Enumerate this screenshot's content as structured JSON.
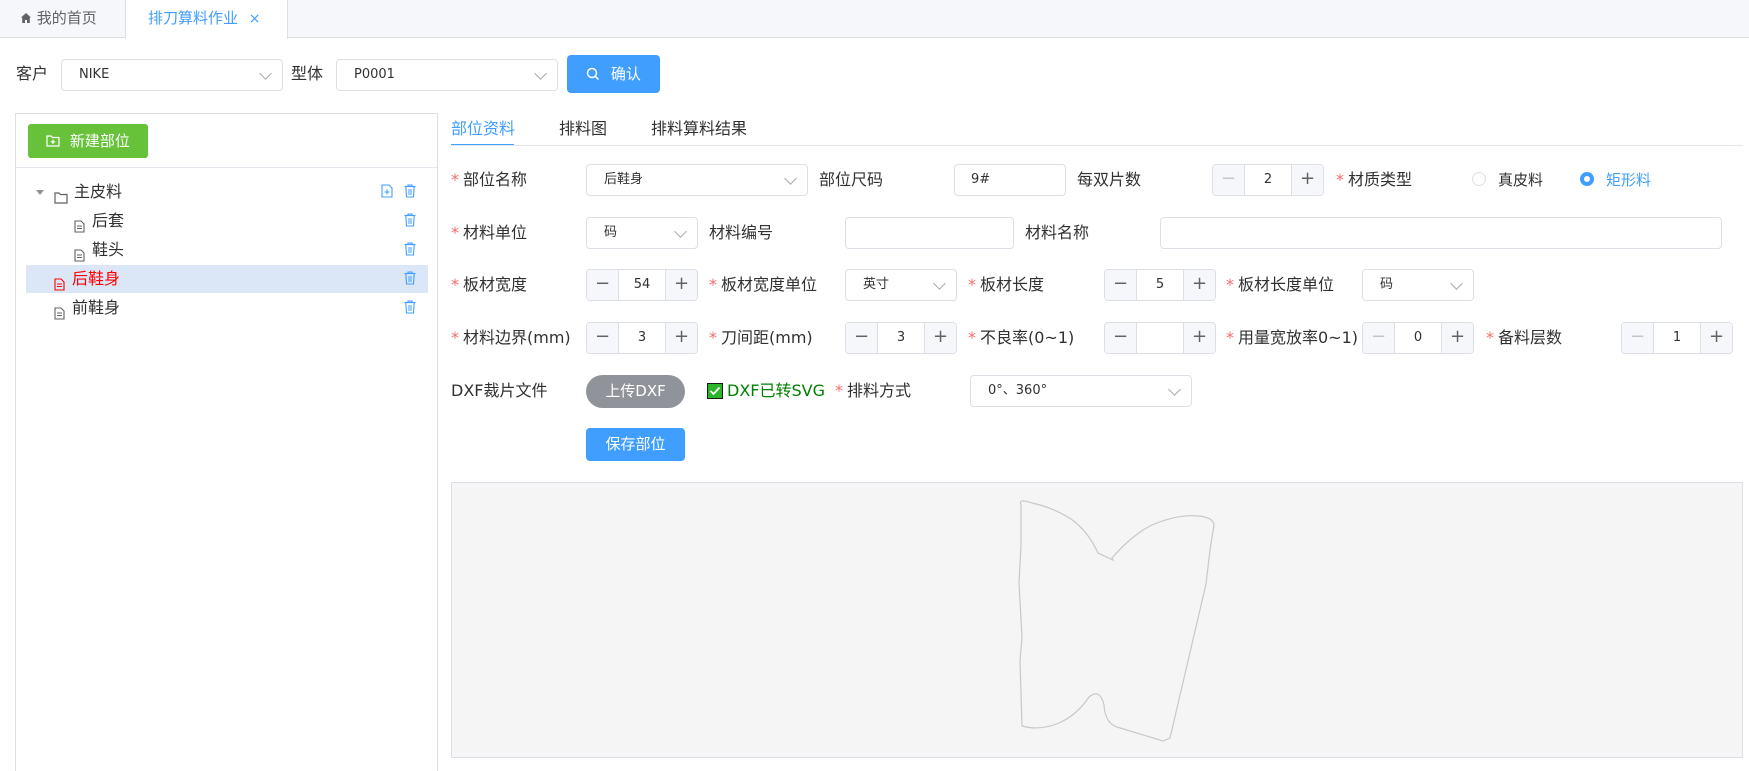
{
  "tabs": {
    "home_label": "我的首页",
    "active_label": "排刀算料作业",
    "close_glyph": "×"
  },
  "toolbar": {
    "customer_label": "客户",
    "customer_value": "NIKE",
    "model_label": "型体",
    "model_value": "P0001",
    "confirm_label": "确认"
  },
  "left": {
    "new_part_label": "新建部位",
    "tree": [
      {
        "label": "主皮料",
        "type": "folder"
      },
      {
        "label": "后套",
        "type": "file"
      },
      {
        "label": "鞋头",
        "type": "file"
      },
      {
        "label": "后鞋身",
        "type": "file",
        "selected": true
      },
      {
        "label": "前鞋身",
        "type": "file"
      }
    ]
  },
  "right_tabs": [
    "部位资料",
    "排料图",
    "排料算料结果"
  ],
  "form": {
    "part_name_label": "部位名称",
    "part_name_value": "后鞋身",
    "part_size_label": "部位尺码",
    "part_size_value": "9#",
    "pieces_per_pair_label": "每双片数",
    "pieces_per_pair_value": "2",
    "material_type_label": "材质类型",
    "material_type_options": [
      "真皮料",
      "矩形料"
    ],
    "material_type_selected": "矩形料",
    "material_unit_label": "材料单位",
    "material_unit_value": "码",
    "material_code_label": "材料编号",
    "material_code_value": "",
    "material_name_label": "材料名称",
    "material_name_value": "",
    "board_width_label": "板材宽度",
    "board_width_value": "54",
    "board_width_unit_label": "板材宽度单位",
    "board_width_unit_value": "英寸",
    "board_length_label": "板材长度",
    "board_length_value": "5",
    "board_length_unit_label": "板材长度单位",
    "board_length_unit_value": "码",
    "material_margin_label": "材料边界(mm)",
    "material_margin_value": "3",
    "knife_gap_label": "刀间距(mm)",
    "knife_gap_value": "3",
    "defect_rate_label": "不良率(0~1)",
    "defect_rate_value": "",
    "usage_ratio_label": "用量宽放率0~1)",
    "usage_ratio_value": "0",
    "spare_layers_label": "备料层数",
    "spare_layers_value": "1",
    "dxf_label": "DXF裁片文件",
    "upload_dxf_label": "上传DXF",
    "dxf_converted_label": "DXF已转SVG",
    "layout_mode_label": "排料方式",
    "layout_mode_value": "0°、360°",
    "save_part_label": "保存部位"
  },
  "colors": {
    "primary": "#409eff",
    "success": "#67c23a",
    "danger": "#f56c6c"
  }
}
